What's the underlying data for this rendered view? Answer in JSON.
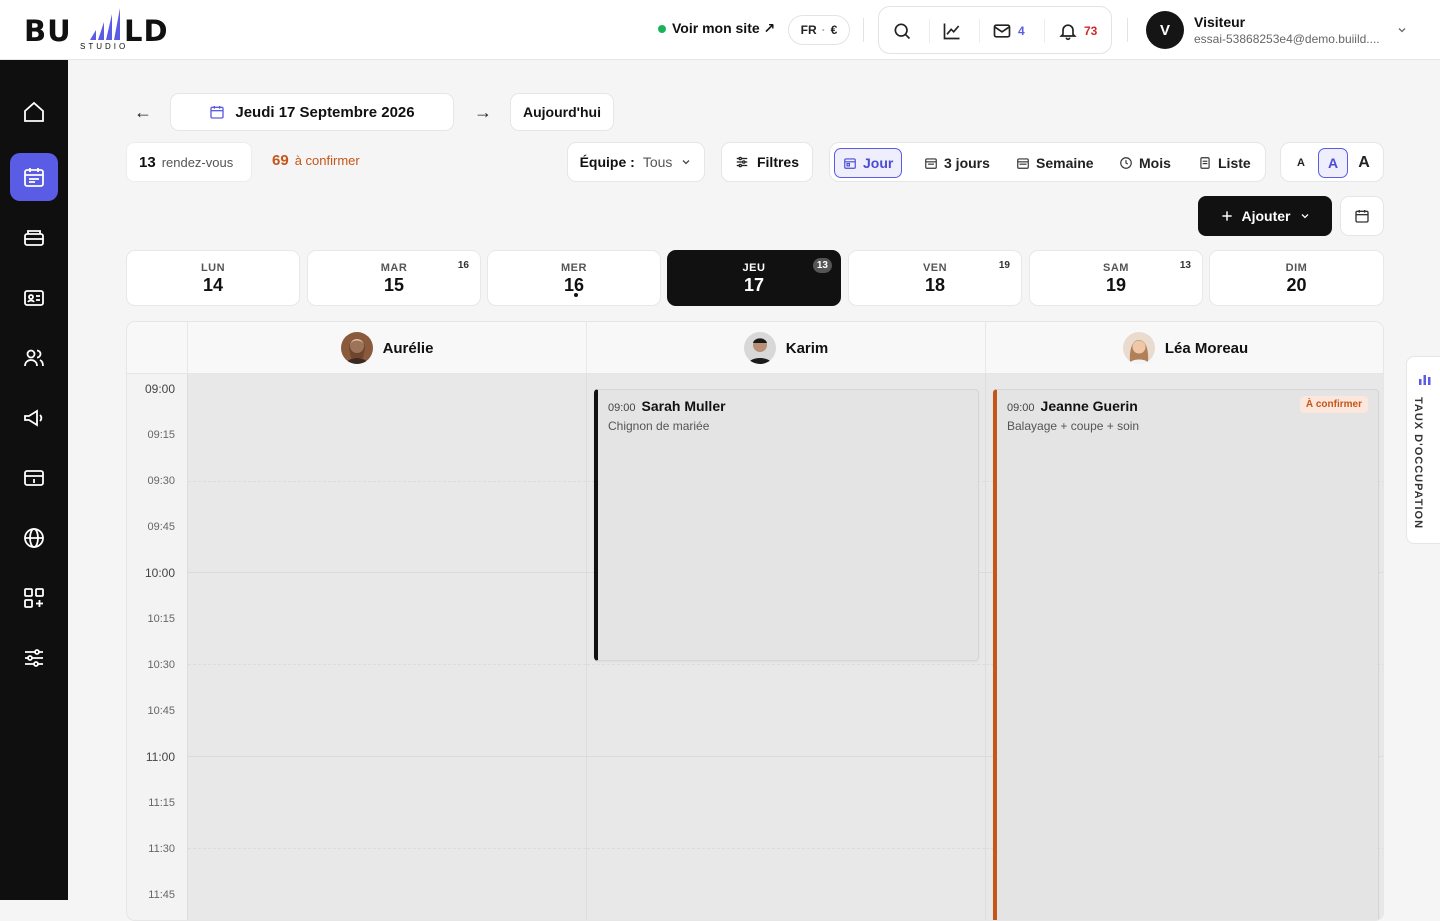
{
  "brand": {
    "logo_text_left": "BU",
    "logo_text_right": "LD",
    "logo_sub": "STUDIO",
    "accent": "#5b5ce6"
  },
  "topbar": {
    "site_link": "Voir mon site ↗",
    "lang": "FR",
    "currency": "€",
    "mail_count": "4",
    "notif_count": "73",
    "user_initial": "V",
    "user_name": "Visiteur",
    "user_email": "essai-53868253e4@demo.buiild...."
  },
  "sidebar": {
    "items": [
      "home-icon",
      "calendar-icon",
      "register-icon",
      "contact-card-icon",
      "users-icon",
      "megaphone-icon",
      "payment-icon",
      "globe-icon",
      "apps-icon",
      "settings-sliders-icon"
    ],
    "active": 1
  },
  "toolbar": {
    "prev": "←",
    "date_label": "Jeudi 17 Septembre 2026",
    "next": "→",
    "today": "Aujourd'hui",
    "appointments_count": "13",
    "appointments_label": "rendez-vous",
    "to_confirm_count": "69",
    "to_confirm_label": "à confirmer",
    "team_label": "Équipe :",
    "team_value": "Tous",
    "filters": "Filtres",
    "views": [
      "Jour",
      "3 jours",
      "Semaine",
      "Mois",
      "Liste"
    ],
    "active_view": "Jour",
    "text_sizes": [
      "A",
      "A",
      "A"
    ],
    "add": "Ajouter"
  },
  "week": [
    {
      "name": "LUN",
      "date": "14",
      "badge": ""
    },
    {
      "name": "MAR",
      "date": "15",
      "badge": "16"
    },
    {
      "name": "MER",
      "date": "16",
      "badge": ""
    },
    {
      "name": "JEU",
      "date": "17",
      "badge": "13"
    },
    {
      "name": "VEN",
      "date": "18",
      "badge": "19"
    },
    {
      "name": "SAM",
      "date": "19",
      "badge": "13"
    },
    {
      "name": "DIM",
      "date": "20",
      "badge": ""
    }
  ],
  "staff": [
    "Aurélie",
    "Karim",
    "Léa Moreau"
  ],
  "times": [
    "09:00",
    "09:15",
    "09:30",
    "09:45",
    "10:00",
    "10:15",
    "10:30",
    "10:45",
    "11:00",
    "11:15",
    "11:30",
    "11:45"
  ],
  "appointments": [
    {
      "time": "09:00",
      "client": "Sarah Muller",
      "service": "Chignon de mariée",
      "tag": ""
    },
    {
      "time": "09:00",
      "client": "Jeanne Guerin",
      "service": "Balayage + coupe + soin",
      "tag": "À confirmer"
    }
  ],
  "occupancy_label": "TAUX D'OCCUPATION"
}
